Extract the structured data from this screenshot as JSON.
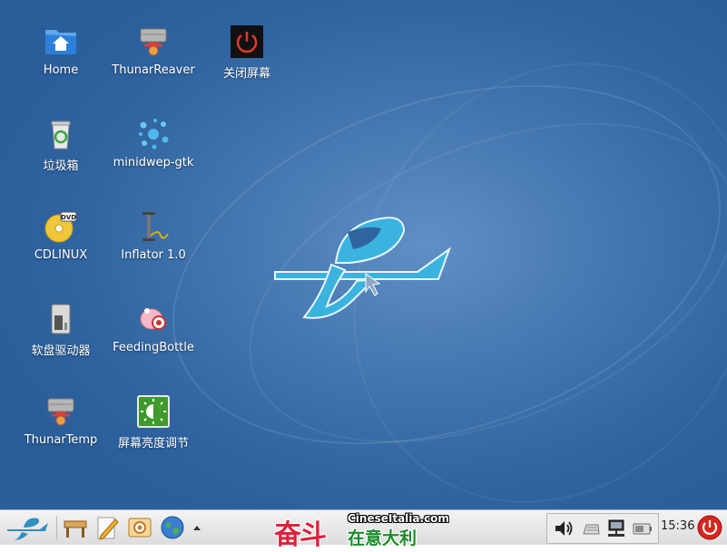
{
  "desktop": {
    "icons": [
      {
        "label": "Home",
        "icon": "home-folder-icon"
      },
      {
        "label": "ThunarReaver",
        "icon": "thunar-reaver-icon"
      },
      {
        "label": "关闭屏幕",
        "icon": "power-off-screen-icon"
      },
      {
        "label": "垃圾箱",
        "icon": "trash-icon"
      },
      {
        "label": "minidwep-gtk",
        "icon": "minidwep-splash-icon"
      },
      {
        "label": "CDLINUX",
        "icon": "dvd-disc-icon"
      },
      {
        "label": "Inflator 1.0",
        "icon": "air-pump-icon"
      },
      {
        "label": "软盘驱动器",
        "icon": "floppy-drive-icon"
      },
      {
        "label": "FeedingBottle",
        "icon": "feeding-bottle-icon"
      },
      {
        "label": "ThunarTemp",
        "icon": "thunar-temp-icon"
      },
      {
        "label": "屏幕亮度调节",
        "icon": "brightness-adjust-icon"
      }
    ]
  },
  "taskbar": {
    "launchers": [
      "start-menu-logo-icon",
      "desk-icon",
      "text-editor-icon",
      "image-viewer-icon",
      "web-browser-globe-icon",
      "launcher-more-arrow-icon"
    ],
    "tray": [
      "volume-icon",
      "keyboard-icon",
      "network-icon",
      "battery-icon"
    ],
    "clock": "15:36",
    "power_icon": "power-button-icon"
  },
  "watermark": {
    "site": "CineseItalia.com",
    "big": "奋斗",
    "small": "在意大利"
  },
  "colors": {
    "desktop_bg": "#3b6ea8",
    "logo": "#3ab4de",
    "taskbar_bg": "#e6e6e6"
  }
}
